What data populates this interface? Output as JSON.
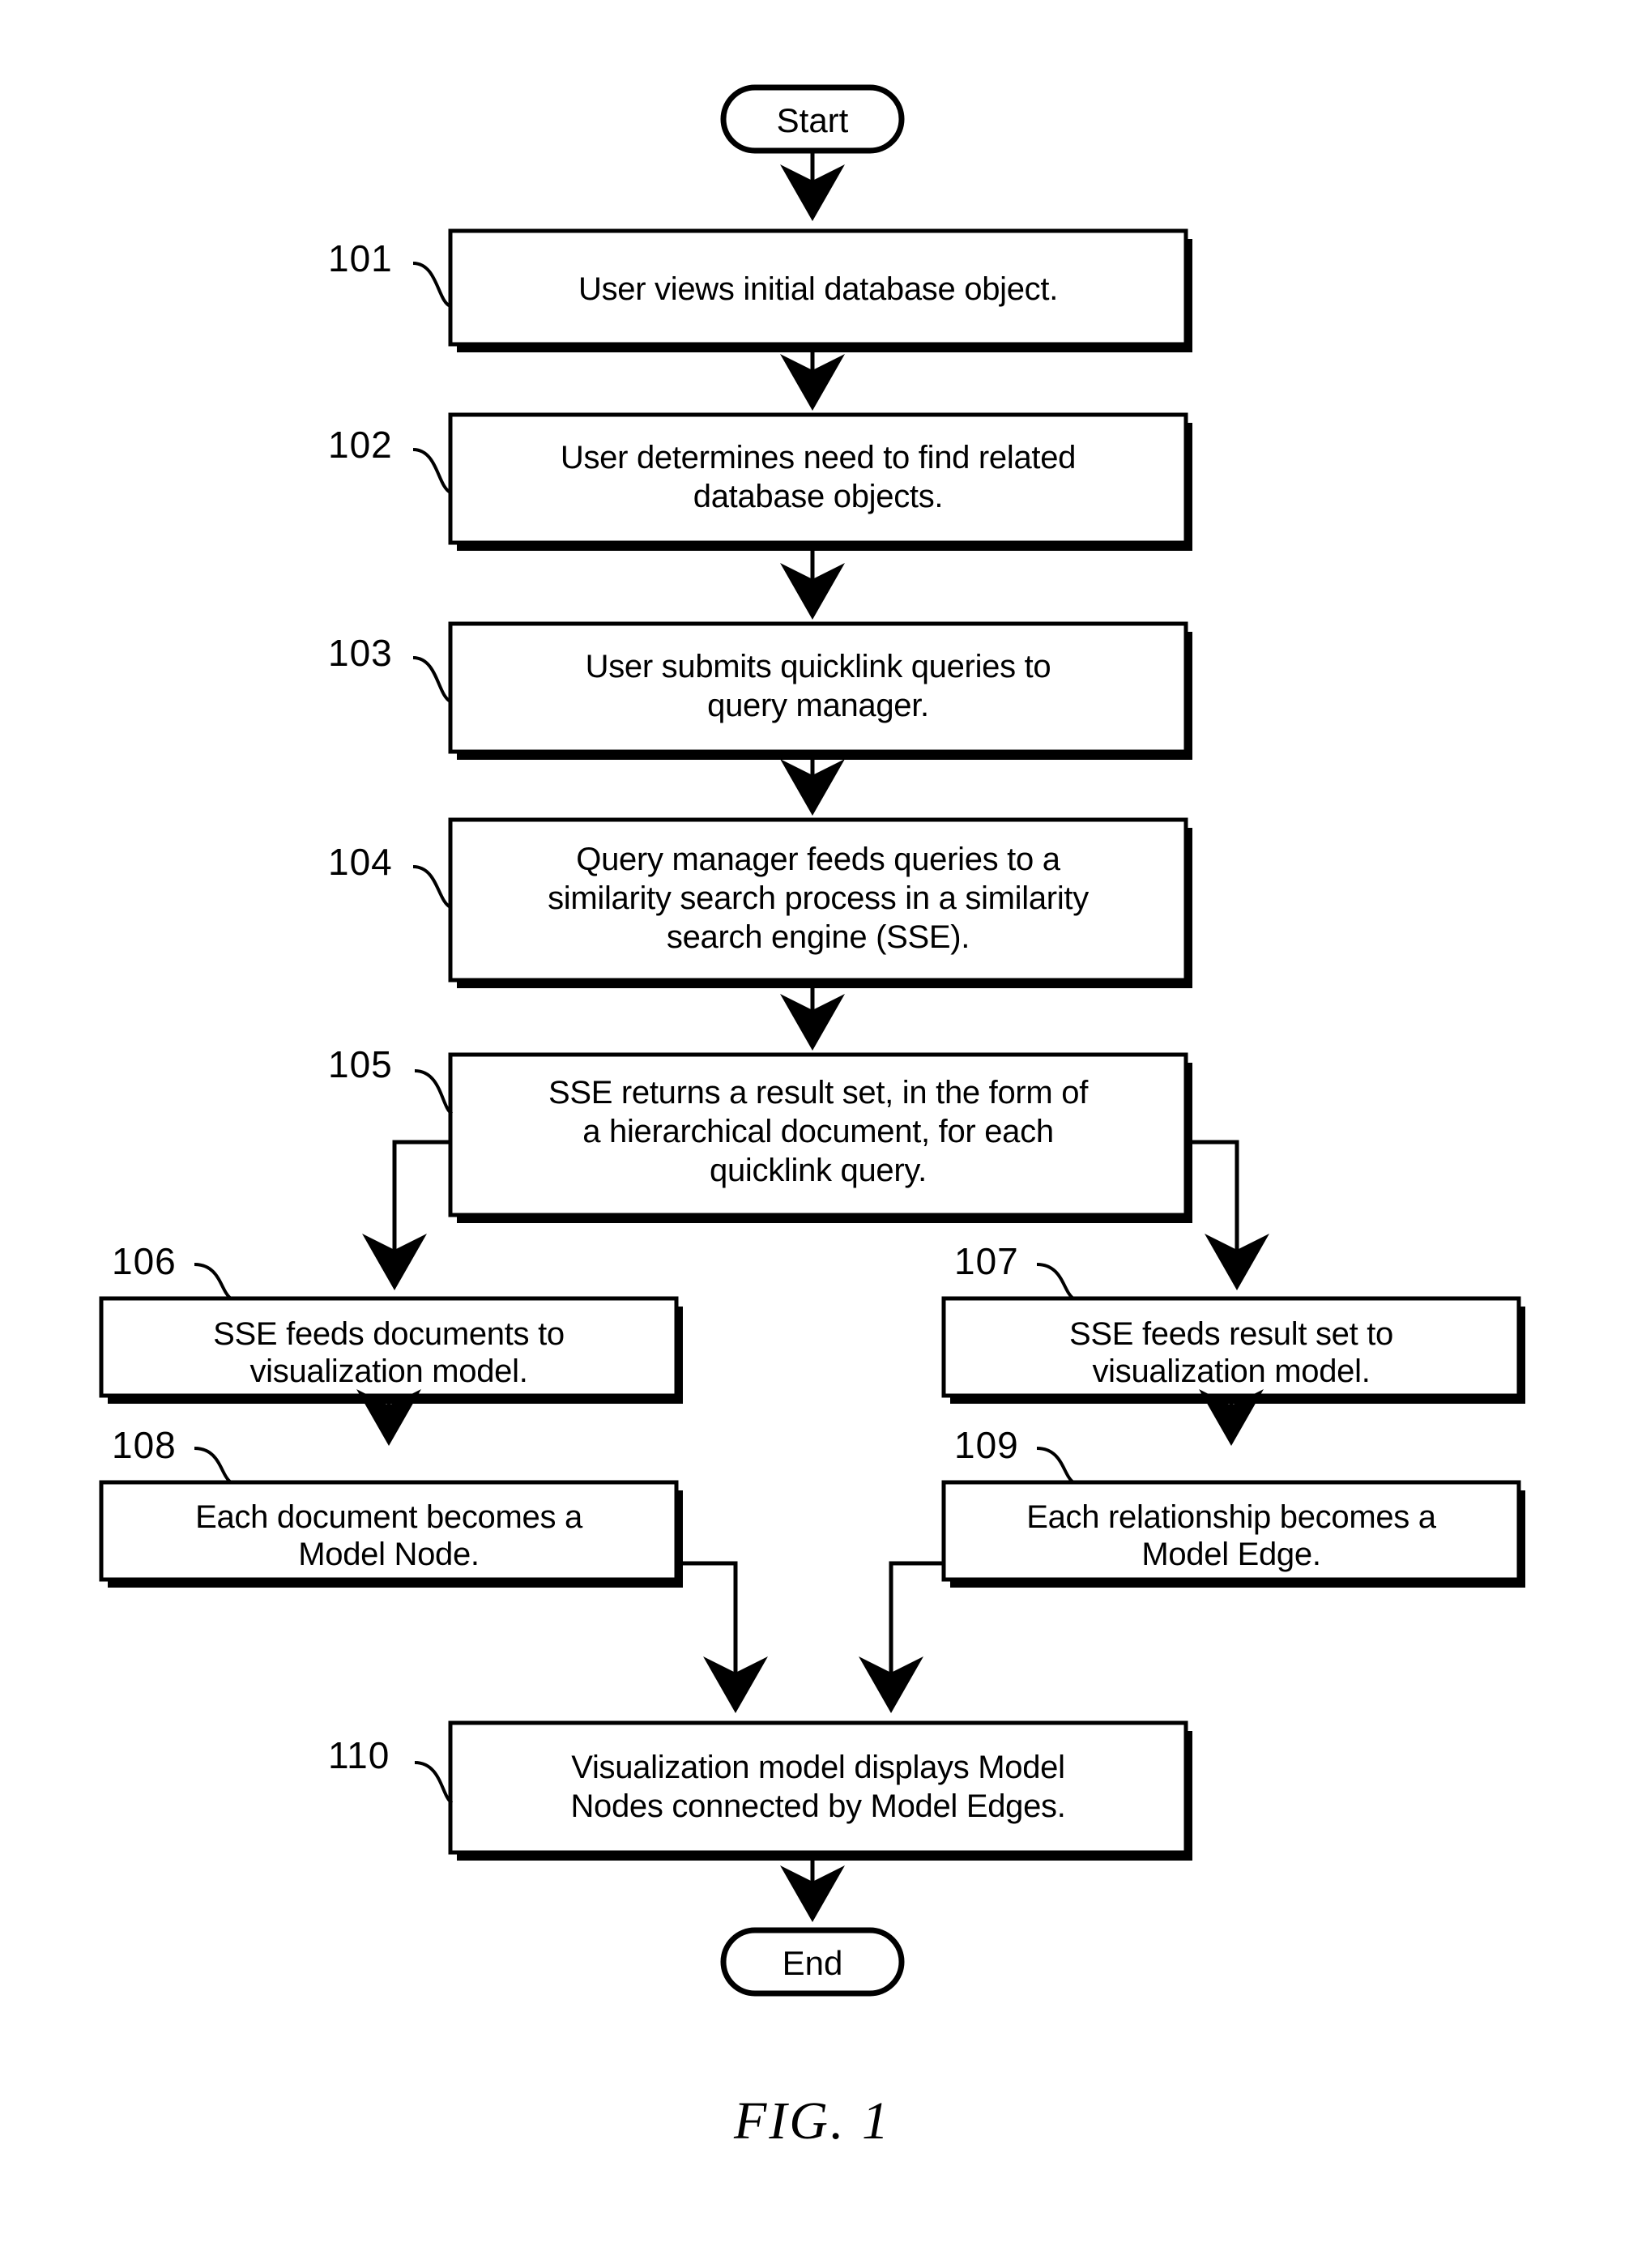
{
  "figure": {
    "caption": "FIG.   1",
    "type": "flowchart"
  },
  "terminals": {
    "start": {
      "label": "Start"
    },
    "end": {
      "label": "End"
    }
  },
  "steps": [
    {
      "ref": "101",
      "lines": [
        "User views initial database object."
      ]
    },
    {
      "ref": "102",
      "lines": [
        "User determines need to find related",
        "database objects."
      ]
    },
    {
      "ref": "103",
      "lines": [
        "User submits quicklink queries to",
        "query manager."
      ]
    },
    {
      "ref": "104",
      "lines": [
        "Query manager feeds queries to a",
        "similarity search process in a similarity",
        "search engine (SSE)."
      ]
    },
    {
      "ref": "105",
      "lines": [
        "SSE returns a result set, in the form of",
        "a hierarchical document, for each",
        "quicklink query."
      ]
    },
    {
      "ref": "106",
      "lines": [
        "SSE feeds documents to",
        "visualization model."
      ]
    },
    {
      "ref": "107",
      "lines": [
        "SSE feeds result set to",
        "visualization model."
      ]
    },
    {
      "ref": "108",
      "lines": [
        "Each document becomes a",
        "Model Node."
      ]
    },
    {
      "ref": "109",
      "lines": [
        "Each relationship becomes a",
        "Model Edge."
      ]
    },
    {
      "ref": "110",
      "lines": [
        "Visualization model displays Model",
        "Nodes connected by Model Edges."
      ]
    }
  ],
  "colors": {
    "ink": "#000000",
    "paper": "#ffffff"
  }
}
